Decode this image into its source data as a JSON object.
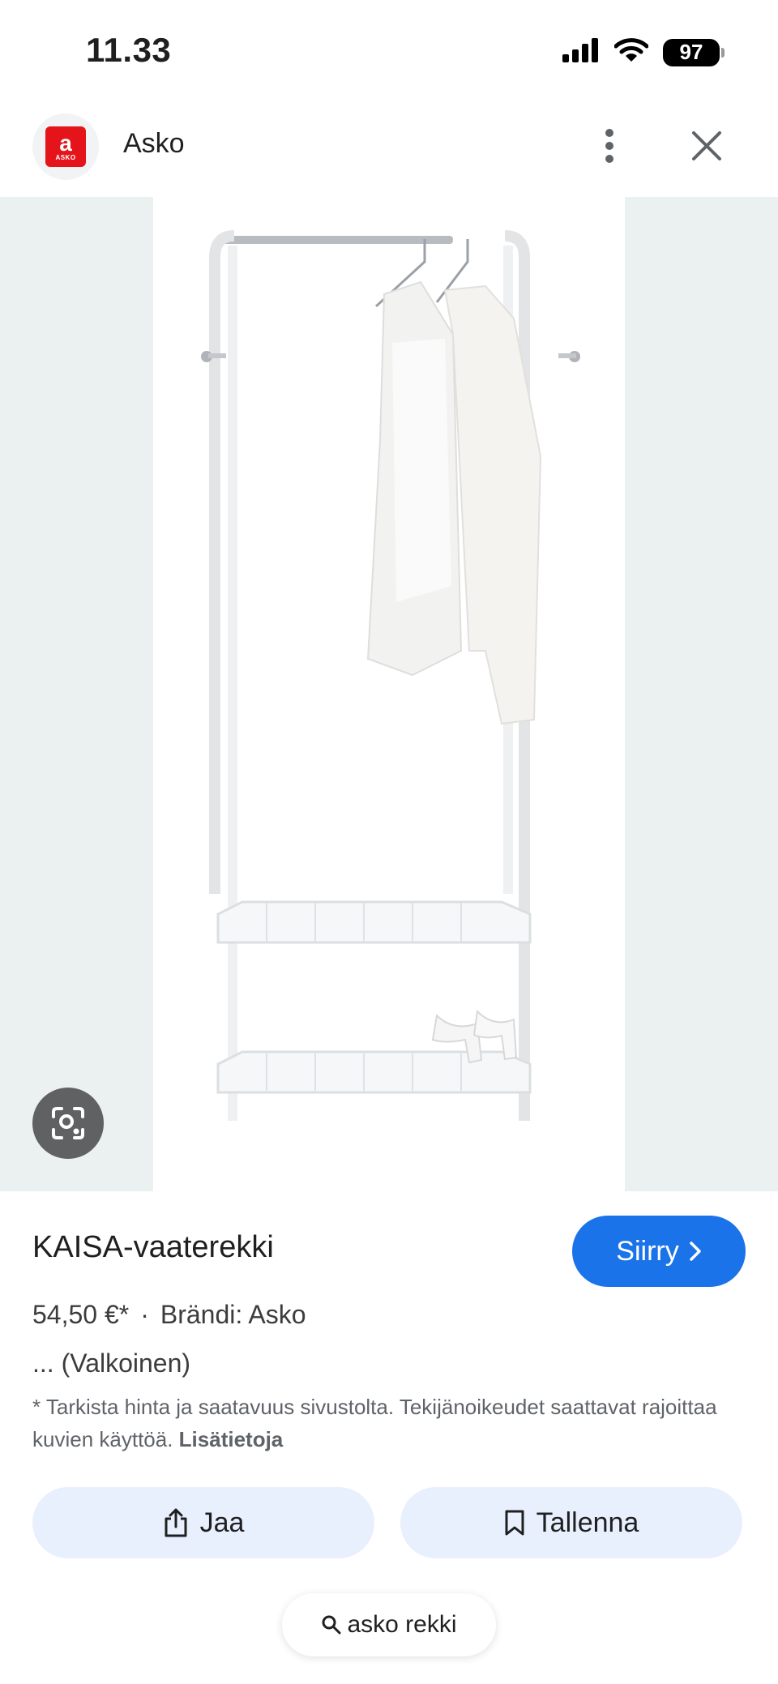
{
  "status_bar": {
    "time": "11.33",
    "battery": "97",
    "icons": [
      "cellular-signal-icon",
      "wifi-icon",
      "battery-icon"
    ]
  },
  "source": {
    "logo_text": "ASKO",
    "name": "Asko",
    "icons": [
      "more-vertical-icon",
      "close-icon"
    ]
  },
  "product": {
    "title": "KAISA-vaaterekki",
    "price": "54,50 €*",
    "separator": "·",
    "brand": "Brändi: Asko",
    "variant": "... (Valkoinen)",
    "disclaimer": "* Tarkista hinta ja saatavuus sivustolta. Tekijänoikeudet saattavat rajoittaa kuvien käyttöä.",
    "disclaimer_link": "Lisätietoja"
  },
  "actions": {
    "visit_label": "Siirry",
    "share_label": "Jaa",
    "save_label": "Tallenna"
  },
  "search_chip": {
    "query": "asko rekki"
  },
  "colors": {
    "accent_blue": "#1a73e8",
    "pill_bg": "#e8f0fe",
    "brand_red": "#e5141b",
    "image_bg": "#ebf0f0"
  }
}
